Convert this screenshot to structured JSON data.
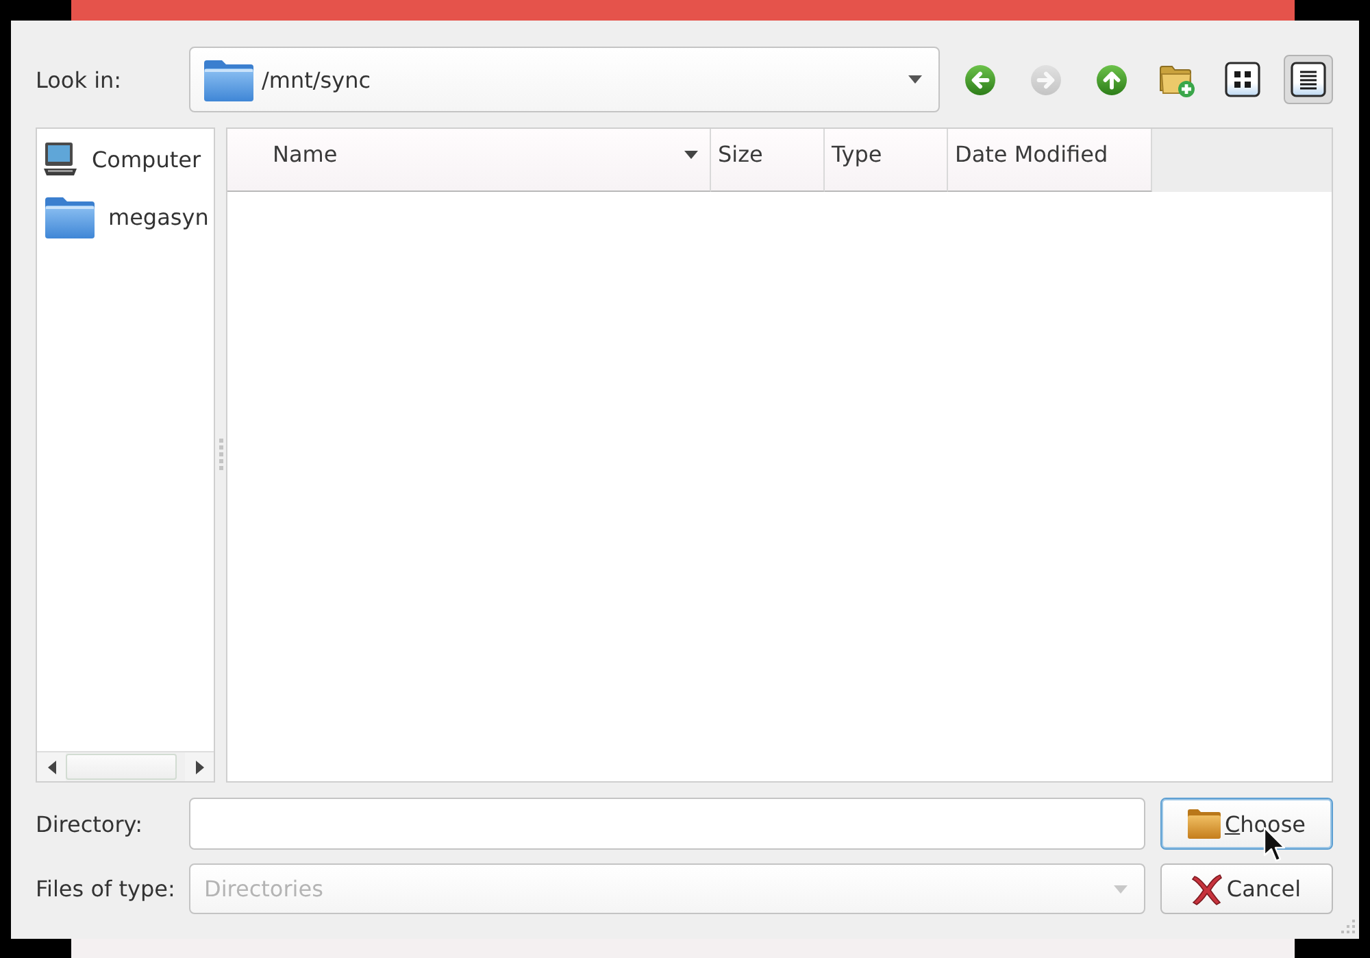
{
  "look_in": {
    "label": "Look in:",
    "value": "/mnt/sync"
  },
  "toolbar": [
    {
      "kind": "back",
      "disabled": false,
      "selected": false
    },
    {
      "kind": "forward",
      "disabled": true,
      "selected": false
    },
    {
      "kind": "up",
      "disabled": false,
      "selected": false
    },
    {
      "kind": "new_folder",
      "disabled": false,
      "selected": false
    },
    {
      "kind": "icon_view",
      "disabled": false,
      "selected": false
    },
    {
      "kind": "detail_view",
      "disabled": false,
      "selected": true
    }
  ],
  "sidebar": {
    "items": [
      {
        "kind": "computer",
        "label": "Computer",
        "selected": false
      },
      {
        "kind": "folder",
        "label": "megasyn",
        "selected": false
      }
    ]
  },
  "file_list": {
    "columns": [
      {
        "label": "Name",
        "sorted": true
      },
      {
        "label": "Size",
        "sorted": false
      },
      {
        "label": "Type",
        "sorted": false
      },
      {
        "label": "Date Modified",
        "sorted": false
      }
    ]
  },
  "directory": {
    "label": "Directory:"
  },
  "file_type": {
    "label": "Files of type:",
    "value": "Directories",
    "disabled": true
  },
  "buttons": [
    {
      "kind": "choose",
      "label": "Choose",
      "focused": true,
      "mnemonic": true
    },
    {
      "kind": "cancel",
      "label": "Cancel",
      "focused": false,
      "mnemonic": false
    }
  ]
}
